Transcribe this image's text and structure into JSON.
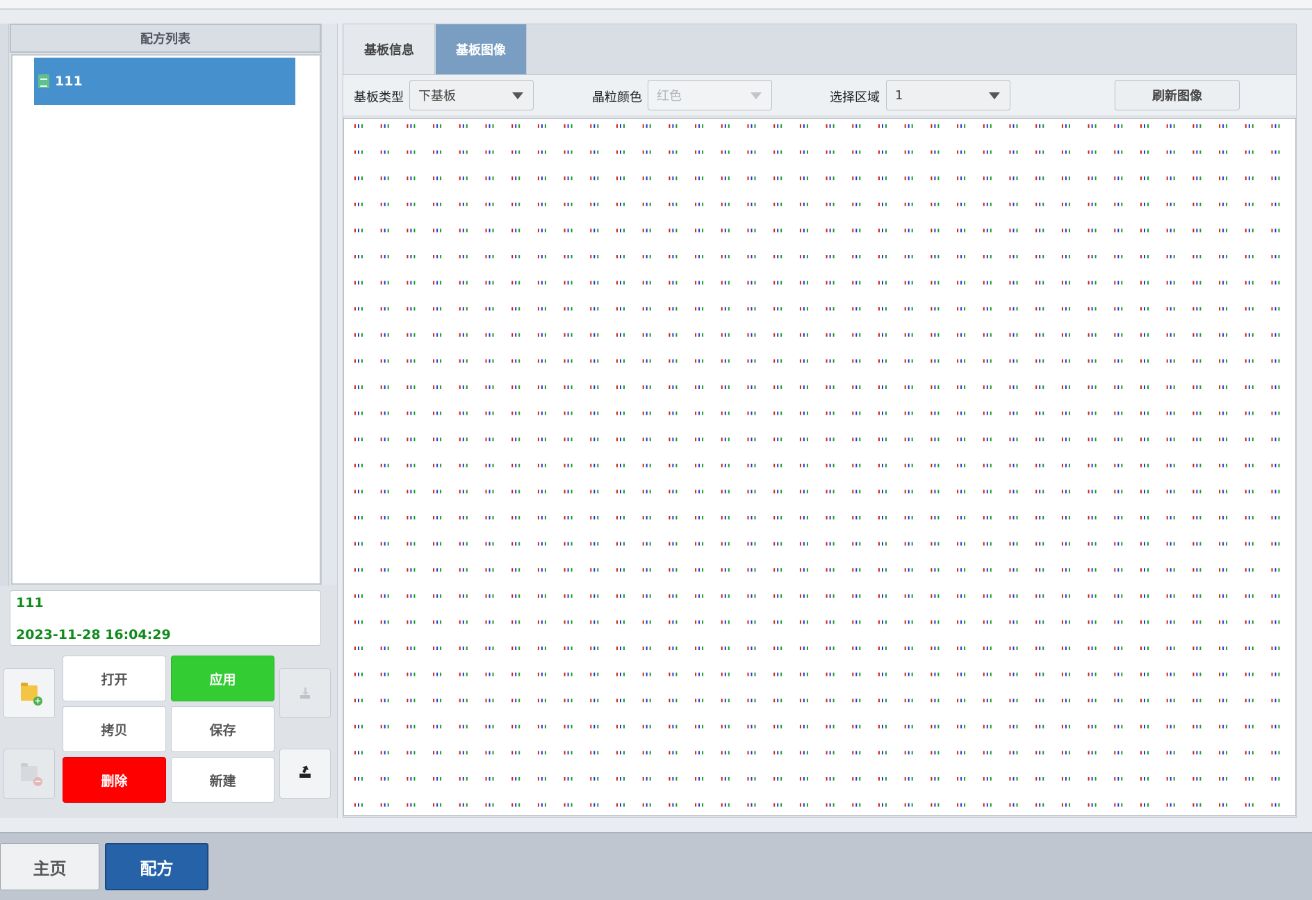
{
  "left_panel": {
    "list_header": "配方列表",
    "items": [
      {
        "label": "111",
        "selected": true
      }
    ],
    "info": {
      "name": "111",
      "timestamp": "2023-11-28 16:04:29"
    },
    "buttons": {
      "open": "打开",
      "apply": "应用",
      "copy": "拷贝",
      "save": "保存",
      "delete": "删除",
      "new": "新建"
    },
    "icons": {
      "add_folder": "folder-add-icon",
      "remove_folder": "folder-remove-icon",
      "import": "import-icon",
      "export": "export-icon"
    }
  },
  "right_panel": {
    "tabs": [
      {
        "label": "基板信息",
        "active": false
      },
      {
        "label": "基板图像",
        "active": true
      }
    ],
    "toolbar": {
      "substrate_type_label": "基板类型",
      "substrate_type_value": "下基板",
      "grain_color_label": "晶粒颜色",
      "grain_color_value": "红色",
      "region_label": "选择区域",
      "region_value": "1",
      "refresh_label": "刷新图像"
    },
    "grid": {
      "columns": 36,
      "rows": 27,
      "colors": [
        "#d42020",
        "#1a3dd8",
        "#1f9a2a"
      ]
    }
  },
  "bottom_nav": {
    "home": "主页",
    "recipe": "配方"
  },
  "colors": {
    "apply_green": "#33cc33",
    "delete_red": "#ff0000",
    "selected_blue": "#4590cd",
    "nav_active": "#2562a8",
    "info_text_green": "#0f8a1b"
  }
}
